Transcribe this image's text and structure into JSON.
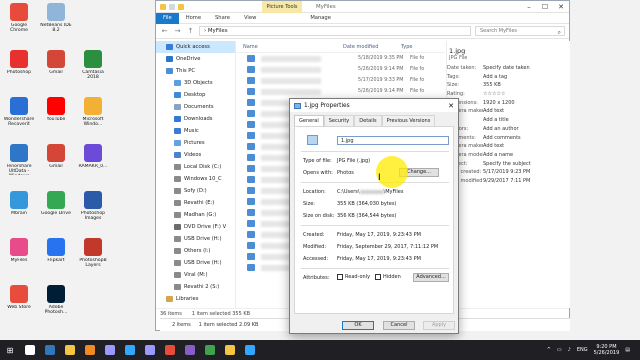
{
  "desktop_icons": [
    {
      "label": "Google Chrome",
      "color": "#e84b3c",
      "col": 0,
      "row": 0
    },
    {
      "label": "NetBeans IDE 8.2",
      "color": "#8fb5d9",
      "col": 1,
      "row": 0
    },
    {
      "label": "Photoshop",
      "color": "#e8312f",
      "col": 0,
      "row": 1
    },
    {
      "label": "Gmail",
      "color": "#d44638",
      "col": 1,
      "row": 1
    },
    {
      "label": "Camtasia 2018",
      "color": "#2c8e3f",
      "col": 2,
      "row": 1
    },
    {
      "label": "Wondershare Recoverit",
      "color": "#2a6fd6",
      "col": 0,
      "row": 2
    },
    {
      "label": "YouTube",
      "color": "#ff0000",
      "col": 1,
      "row": 2
    },
    {
      "label": "Microsoft Windo...",
      "color": "#f2b134",
      "col": 2,
      "row": 2
    },
    {
      "label": "Tenorshare UltData - Windows",
      "color": "#2d76c8",
      "col": 0,
      "row": 3
    },
    {
      "label": "Gmail",
      "color": "#d44638",
      "col": 1,
      "row": 3
    },
    {
      "label": "RAMAKR_0...",
      "color": "#6c4bd8",
      "col": 2,
      "row": 3
    },
    {
      "label": "Mbrain",
      "color": "#3498db",
      "col": 0,
      "row": 4
    },
    {
      "label": "Google Drive",
      "color": "#34a853",
      "col": 1,
      "row": 4
    },
    {
      "label": "Photoshop Images",
      "color": "#2b5ba8",
      "col": 2,
      "row": 4
    },
    {
      "label": "MyFiles",
      "color": "#e84b8a",
      "col": 0,
      "row": 5
    },
    {
      "label": "Flipkart",
      "color": "#2874f0",
      "col": 1,
      "row": 5
    },
    {
      "label": "PhotoshopB Layers",
      "color": "#c0392b",
      "col": 2,
      "row": 5
    },
    {
      "label": "Web Store",
      "color": "#e74c3c",
      "col": 0,
      "row": 6
    },
    {
      "label": "Adobe Photosh...",
      "color": "#001e36",
      "col": 1,
      "row": 6
    }
  ],
  "explorer": {
    "picture_tools": "Picture Tools",
    "window_title": "MyFiles",
    "ribbon": {
      "file": "File",
      "home": "Home",
      "share": "Share",
      "view": "View",
      "manage": "Manage"
    },
    "address": "MyFiles",
    "search_placeholder": "Search MyFiles",
    "columns": {
      "name": "Name",
      "date": "Date modified",
      "type": "Type"
    },
    "rows": [
      {
        "date": "5/18/2019 9:35 PM",
        "type": "File fo"
      },
      {
        "date": "5/26/2019 9:14 PM",
        "type": "File fo"
      },
      {
        "date": "5/17/2019 9:33 PM",
        "type": "File fo"
      },
      {
        "date": "5/26/2019 9:14 PM",
        "type": "File fo"
      },
      {
        "date": "5/17/2019 9:12 PM",
        "type": "File fo"
      },
      {
        "date": "",
        "type": ""
      },
      {
        "date": "",
        "type": ""
      },
      {
        "date": "",
        "type": ""
      },
      {
        "date": "",
        "type": ""
      },
      {
        "date": "",
        "type": ""
      },
      {
        "date": "",
        "type": ""
      },
      {
        "date": "",
        "type": ""
      },
      {
        "date": "",
        "type": ""
      },
      {
        "date": "",
        "type": ""
      },
      {
        "date": "",
        "type": ""
      },
      {
        "date": "",
        "type": ""
      },
      {
        "date": "",
        "type": ""
      },
      {
        "date": "",
        "type": ""
      },
      {
        "date": "",
        "type": ""
      },
      {
        "date": "",
        "type": ""
      }
    ],
    "nav": [
      {
        "label": "Quick access",
        "level": 1,
        "color": "#3a7bd5",
        "selected": true
      },
      {
        "label": "OneDrive",
        "level": 1,
        "color": "#2a74c9",
        "selected": false
      },
      {
        "label": "This PC",
        "level": 1,
        "color": "#4a90d9",
        "selected": false
      },
      {
        "label": "3D Objects",
        "level": 2,
        "color": "#5a9fdf",
        "selected": false
      },
      {
        "label": "Desktop",
        "level": 2,
        "color": "#3c8bd9",
        "selected": false
      },
      {
        "label": "Documents",
        "level": 2,
        "color": "#8aa3c2",
        "selected": false
      },
      {
        "label": "Downloads",
        "level": 2,
        "color": "#2f7ad6",
        "selected": false
      },
      {
        "label": "Music",
        "level": 2,
        "color": "#3a7bd5",
        "selected": false
      },
      {
        "label": "Pictures",
        "level": 2,
        "color": "#5fa3e0",
        "selected": false
      },
      {
        "label": "Videos",
        "level": 2,
        "color": "#4b83c8",
        "selected": false
      },
      {
        "label": "Local Disk (C:)",
        "level": 2,
        "color": "#8a8a8a",
        "selected": false
      },
      {
        "label": "Windows 10_C",
        "level": 2,
        "color": "#8a8a8a",
        "selected": false
      },
      {
        "label": "Sofy (D:)",
        "level": 2,
        "color": "#8a8a8a",
        "selected": false
      },
      {
        "label": "Revathi (E:)",
        "level": 2,
        "color": "#8a8a8a",
        "selected": false
      },
      {
        "label": "Madhan (G:)",
        "level": 2,
        "color": "#8a8a8a",
        "selected": false
      },
      {
        "label": "DVD Drive (F:) V",
        "level": 2,
        "color": "#6a6a6a",
        "selected": false
      },
      {
        "label": "USB Drive (H:)",
        "level": 2,
        "color": "#8a8a8a",
        "selected": false
      },
      {
        "label": "Others (I:)",
        "level": 2,
        "color": "#8a8a8a",
        "selected": false
      },
      {
        "label": "USB Drive (H:)",
        "level": 2,
        "color": "#8a8a8a",
        "selected": false
      },
      {
        "label": "Viral (M:)",
        "level": 2,
        "color": "#8a8a8a",
        "selected": false
      },
      {
        "label": "Revathi 2 (S:)",
        "level": 2,
        "color": "#8a8a8a",
        "selected": false
      },
      {
        "label": "Libraries",
        "level": 1,
        "color": "#d4a54a",
        "selected": false
      }
    ],
    "details": {
      "filename": "1.jpg",
      "filetype": "JPG File",
      "rows": [
        {
          "k": "Date taken:",
          "v": "Specify date taken"
        },
        {
          "k": "Tags:",
          "v": "Add a tag"
        },
        {
          "k": "Size:",
          "v": "355 KB"
        },
        {
          "k": "Rating:",
          "v": "☆☆☆☆☆"
        },
        {
          "k": "Dimensions:",
          "v": "1920 x 1200"
        },
        {
          "k": "Camera maker:",
          "v": "Add text"
        },
        {
          "k": "Title:",
          "v": "Add a title"
        },
        {
          "k": "Authors:",
          "v": "Add an author"
        },
        {
          "k": "Comments:",
          "v": "Add comments"
        },
        {
          "k": "Camera maker:",
          "v": "Add text"
        },
        {
          "k": "Camera model:",
          "v": "Add a name"
        },
        {
          "k": "Subject:",
          "v": "Specify the subject"
        },
        {
          "k": "Date created:",
          "v": "5/17/2019 9:23 PM"
        },
        {
          "k": "Date modified:",
          "v": "9/29/2017 7:11 PM"
        }
      ]
    },
    "status": {
      "items": "36 items",
      "selected": "1 item selected  355 KB"
    }
  },
  "bg_status": {
    "items": "2 items",
    "selected": "1 item selected  2.09 KB"
  },
  "dialog": {
    "title": "1.jpg Properties",
    "tabs": [
      "General",
      "Security",
      "Details",
      "Previous Versions"
    ],
    "filename": "1.jpg",
    "type_label": "Type of file:",
    "type_value": "JPG File (.jpg)",
    "opens_label": "Opens with:",
    "opens_value": "Photos",
    "change_btn": "Change...",
    "location_label": "Location:",
    "location_prefix": "C:\\Users\\",
    "location_suffix": "\\MyFiles",
    "size_label": "Size:",
    "size_value": "355 KB (364,030 bytes)",
    "disk_label": "Size on disk:",
    "disk_value": "356 KB (364,544 bytes)",
    "created_label": "Created:",
    "created_value": "Friday, May 17, 2019, 9:23:43 PM",
    "modified_label": "Modified:",
    "modified_value": "Friday, September 29, 2017, 7:11:12 PM",
    "accessed_label": "Accessed:",
    "accessed_value": "Friday, May 17, 2019, 9:23:43 PM",
    "attributes_label": "Attributes:",
    "readonly": "Read-only",
    "hidden": "Hidden",
    "advanced_btn": "Advanced...",
    "ok": "OK",
    "cancel": "Cancel",
    "apply": "Apply"
  },
  "taskbar": {
    "apps": [
      {
        "name": "task-view-icon",
        "color": "#ffffff"
      },
      {
        "name": "edge-icon",
        "color": "#3277bc"
      },
      {
        "name": "file-explorer-icon",
        "color": "#f4c542"
      },
      {
        "name": "vlc-icon",
        "color": "#f08a24"
      },
      {
        "name": "premiere-icon",
        "color": "#9999ff"
      },
      {
        "name": "photoshop-icon",
        "color": "#31a8ff"
      },
      {
        "name": "after-effects-icon",
        "color": "#9999ff"
      },
      {
        "name": "chrome-icon",
        "color": "#e84b3c"
      },
      {
        "name": "visual-studio-icon",
        "color": "#865fc5"
      },
      {
        "name": "camtasia-icon",
        "color": "#3fa34d"
      },
      {
        "name": "explorer2-icon",
        "color": "#f4c542"
      },
      {
        "name": "photoshop2-icon",
        "color": "#31a8ff"
      }
    ],
    "lang": "ENG",
    "time": "9:20 PM",
    "date": "5/26/2019"
  }
}
